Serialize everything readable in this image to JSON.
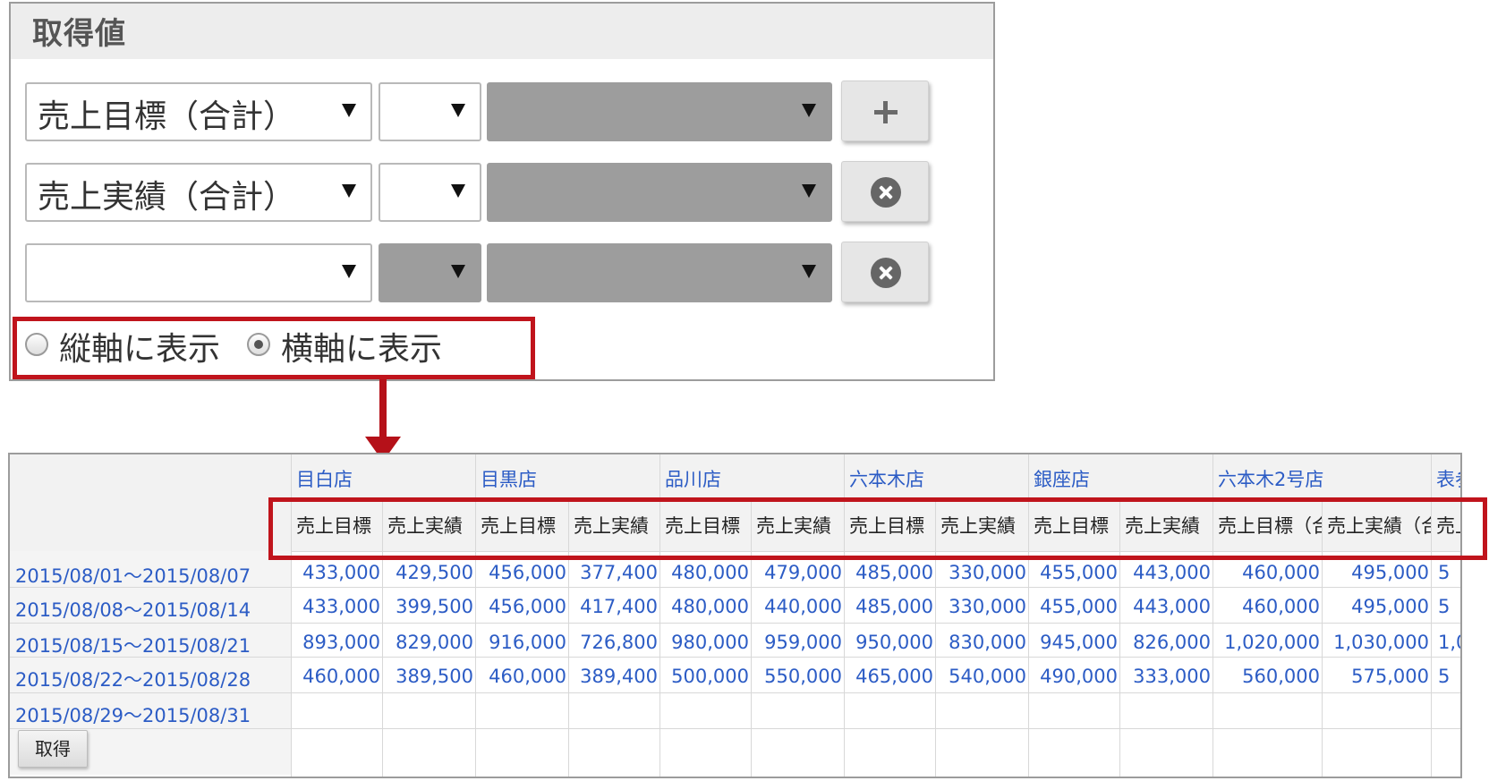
{
  "panel": {
    "title": "取得値",
    "rows": [
      {
        "field": "売上目標（合計）",
        "agg": "",
        "extra": "",
        "button": "plus-icon"
      },
      {
        "field": "売上実績（合計）",
        "agg": "",
        "extra": "",
        "button": "remove-circle-icon"
      },
      {
        "field": "",
        "agg": "",
        "extra": "",
        "button": "remove-circle-icon"
      }
    ],
    "radio": {
      "vertical_label": "縦軸に表示",
      "horizontal_label": "横軸に表示",
      "selected": "horizontal"
    }
  },
  "table": {
    "stores": [
      "目白店",
      "目黒店",
      "品川店",
      "六本木店",
      "銀座店",
      "六本木2号店",
      "表参"
    ],
    "sub_headers": [
      "売上目標",
      "売上実績",
      "売上目標",
      "売上実績",
      "売上目標",
      "売上実績",
      "売上目標",
      "売上実績",
      "売上目標",
      "売上実績",
      "売上目標（合",
      "売上実績（合",
      "売上"
    ],
    "rows": [
      {
        "date": "2015/08/01～2015/08/07",
        "values": [
          "433,000",
          "429,500",
          "456,000",
          "377,400",
          "480,000",
          "479,000",
          "485,000",
          "330,000",
          "455,000",
          "443,000",
          "460,000",
          "495,000",
          "5"
        ]
      },
      {
        "date": "2015/08/08～2015/08/14",
        "values": [
          "433,000",
          "399,500",
          "456,000",
          "417,400",
          "480,000",
          "440,000",
          "485,000",
          "330,000",
          "455,000",
          "443,000",
          "460,000",
          "495,000",
          "5"
        ]
      },
      {
        "date": "2015/08/15～2015/08/21",
        "values": [
          "893,000",
          "829,000",
          "916,000",
          "726,800",
          "980,000",
          "959,000",
          "950,000",
          "830,000",
          "945,000",
          "826,000",
          "1,020,000",
          "1,030,000",
          "1,0"
        ]
      },
      {
        "date": "2015/08/22～2015/08/28",
        "values": [
          "460,000",
          "389,500",
          "460,000",
          "389,400",
          "500,000",
          "550,000",
          "465,000",
          "540,000",
          "490,000",
          "333,000",
          "560,000",
          "575,000",
          "5"
        ]
      },
      {
        "date": "2015/08/29～2015/08/31",
        "values": [
          "",
          "",
          "",
          "",
          "",
          "",
          "",
          "",
          "",
          "",
          "",
          "",
          ""
        ]
      }
    ],
    "fetch_button": "取得"
  },
  "colors": {
    "highlight": "#c0141c",
    "link": "#2c5cc5"
  }
}
